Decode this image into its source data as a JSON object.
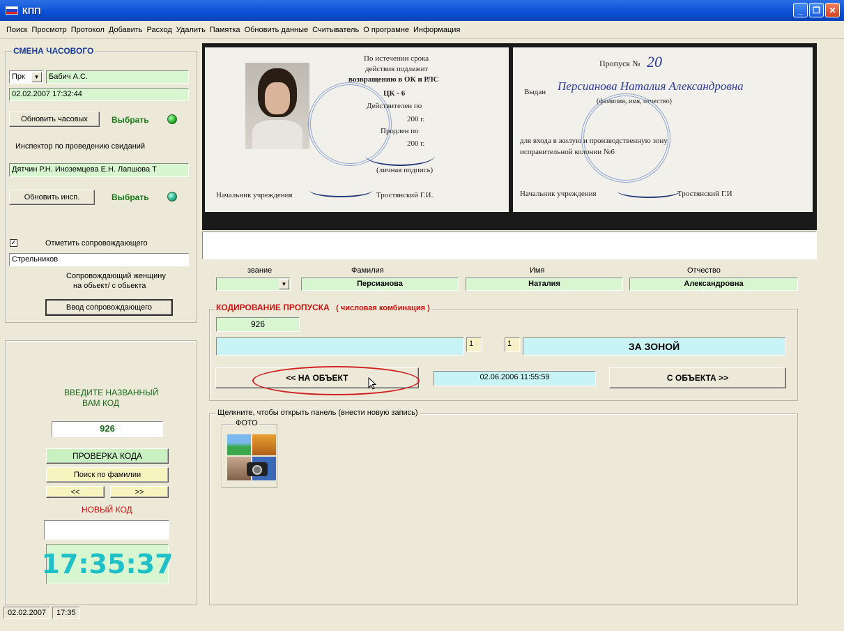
{
  "window": {
    "title": "КПП",
    "flag_colors": [
      "#ffffff",
      "#2244cc",
      "#dd2222"
    ]
  },
  "menu": [
    "Поиск",
    "Просмотр",
    "Протокол",
    "Добавить",
    "Расход",
    "Удалить",
    "Памятка",
    "Обновить данные",
    "Считыватель",
    "О програмне",
    "Информация"
  ],
  "guard": {
    "group_title": "СМЕНА ЧАСОВОГО",
    "rank": "Прк",
    "name": "Бабич А.С.",
    "datetime": "02.02.2007 17:32:44",
    "refresh_guards_label": "Обновить часовых",
    "select_label": "Выбрать",
    "inspector_heading": "Инспектор по проведению свиданий",
    "inspectors": "Дятчин Р.Н. Иноземцева Е.Н. Лапшова Т",
    "refresh_insp_label": "Обновить инсп.",
    "select2_label": "Выбрать",
    "escort_checkbox_label": "Отметить сопровождающего",
    "escort_checked": true,
    "escort_name": "Стрельников",
    "escort_note_1": "Сопровождающий женщину",
    "escort_note_2": "на обьект/ с обьекта",
    "escort_button": "Ввод сопровождающего"
  },
  "code_panel": {
    "heading_1": "ВВЕДИТЕ НАЗВАННЫЙ",
    "heading_2": "ВАМ КОД",
    "code": "926",
    "check_code": "ПРОВЕРКА КОДА",
    "search_by_name": "Поиск по фамилии",
    "prev": "<<",
    "next": ">>",
    "new_code_label": "НОВЫЙ КОД",
    "new_code": "",
    "clock": "17:35:37"
  },
  "pass_card": {
    "left": {
      "lines": [
        "По истечении срока",
        "действия подлежит",
        "возвращению в ОК и РЛС",
        "ЦК - 6",
        "Действителен по",
        "200 г.",
        "Продлен по",
        "200 г.",
        "(личная подпись)"
      ],
      "chief": "Начальник учреждения",
      "chief_name": "Тростянский Г.И."
    },
    "right": {
      "pass_no_label": "Пропуск №",
      "pass_no": "20",
      "issued_label": "Выдан",
      "issued_to": "Персианова Наталия Александровна",
      "caption": "(фамилия, имя, отчество)",
      "purpose_1": "для входа в жилую и производственную зону",
      "purpose_2": "исправительной колонии №6",
      "chief": "Начальник учреждения",
      "chief_name": "Тростянский Г.И"
    }
  },
  "person": {
    "rank_label": "звание",
    "rank_value": "",
    "surname_label": "Фамилия",
    "surname": "Персианова",
    "name_label": "Имя",
    "name": "Наталия",
    "patronymic_label": "Отчество",
    "patronymic": "Александровна"
  },
  "coding": {
    "group_title": "КОДИРОВАНИЕ ПРОПУСКА",
    "group_subtitle": "( числовая комбинация )",
    "code": "926",
    "long_field": "",
    "num1": "1",
    "num2": "1",
    "status": "ЗА ЗОНОЙ",
    "to_object": "<< НА ОБЪЕКТ",
    "timestamp": "02.06.2006 11:55:59",
    "from_object": "С ОБЪЕКТА >>"
  },
  "records": {
    "group_title": "Щелкните, чтобы открыть панель (внести новую запись)",
    "photo_group_title": "ФОТО"
  },
  "status": {
    "date": "02.02.2007",
    "time": "17:35"
  }
}
